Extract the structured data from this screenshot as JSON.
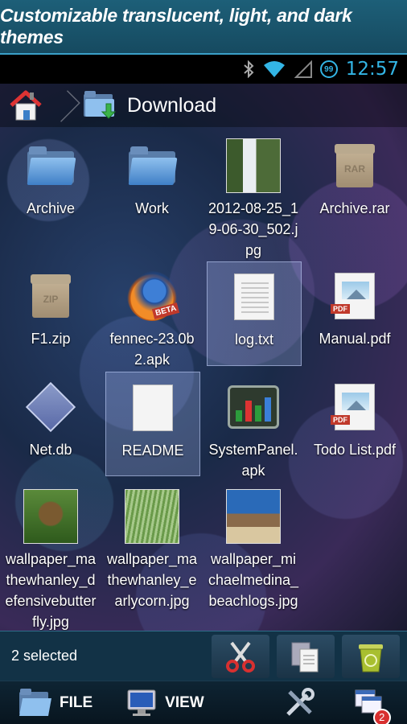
{
  "promo": {
    "title": "Customizable translucent, light, and dark themes"
  },
  "status": {
    "battery": "99",
    "time": "12:57"
  },
  "breadcrumb": {
    "current": "Download"
  },
  "items": [
    {
      "name": "Archive",
      "type": "folder"
    },
    {
      "name": "Work",
      "type": "folder"
    },
    {
      "name": "2012-08-25_19-06-30_502.jpg",
      "type": "photo"
    },
    {
      "name": "Archive.rar",
      "type": "rar"
    },
    {
      "name": "F1.zip",
      "type": "zip"
    },
    {
      "name": "fennec-23.0b2.apk",
      "type": "apk-fox"
    },
    {
      "name": "log.txt",
      "type": "text",
      "selected": true
    },
    {
      "name": "Manual.pdf",
      "type": "pdf"
    },
    {
      "name": "Net.db",
      "type": "db"
    },
    {
      "name": "README",
      "type": "text",
      "selected": true
    },
    {
      "name": "SystemPanel.apk",
      "type": "apk-sys"
    },
    {
      "name": "Todo List.pdf",
      "type": "pdf"
    },
    {
      "name": "wallpaper_mathewhanley_defensivebutterfly.jpg",
      "type": "photo"
    },
    {
      "name": "wallpaper_mathewhanley_earlycorn.jpg",
      "type": "photo"
    },
    {
      "name": "wallpaper_michaelmedina_beachlogs.jpg",
      "type": "photo"
    }
  ],
  "selection": {
    "count_text": "2 selected"
  },
  "toolbar": {
    "file": "FILE",
    "view": "VIEW",
    "windows_badge": "2"
  },
  "colors": {
    "accent": "#33b5e5",
    "promo_bg": "#1d5f78"
  }
}
